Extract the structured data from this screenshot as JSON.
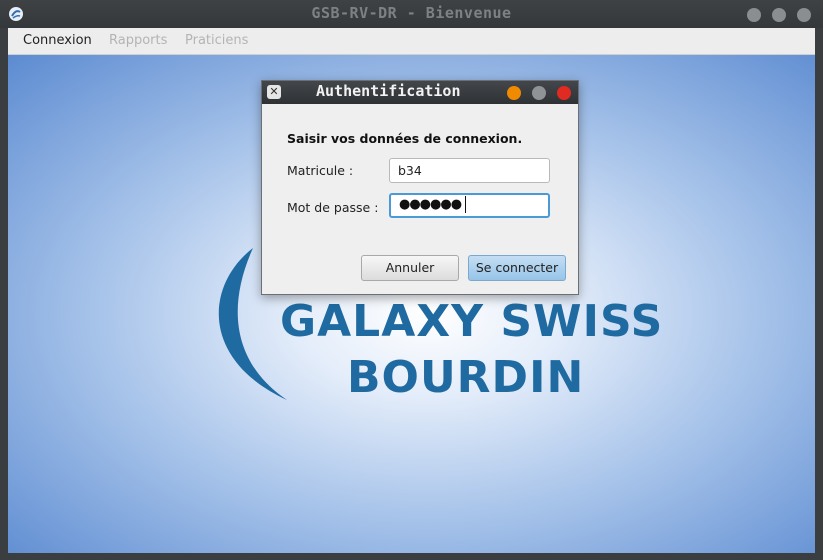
{
  "window": {
    "title": "GSB-RV-DR - Bienvenue",
    "icon": "java-app-icon",
    "controls": [
      "minimize-button",
      "maximize-button",
      "close-button"
    ]
  },
  "menubar": {
    "items": [
      {
        "label": "Connexion",
        "enabled": true
      },
      {
        "label": "Rapports",
        "enabled": false
      },
      {
        "label": "Praticiens",
        "enabled": false
      }
    ]
  },
  "logo": {
    "line1": "GALAXY SWISS",
    "line2": "BOURDIN",
    "color": "#1f6aa1"
  },
  "dialog": {
    "title": "Authentification",
    "heading": "Saisir vos données de connexion.",
    "matricule_label": "Matricule :",
    "matricule_value": "b34",
    "password_label": "Mot de passe :",
    "password_mask": "●●●●●●",
    "cancel_label": "Annuler",
    "connect_label": "Se connecter",
    "dot_colors": [
      "#f08a00",
      "#8f9396",
      "#e12a22"
    ]
  }
}
